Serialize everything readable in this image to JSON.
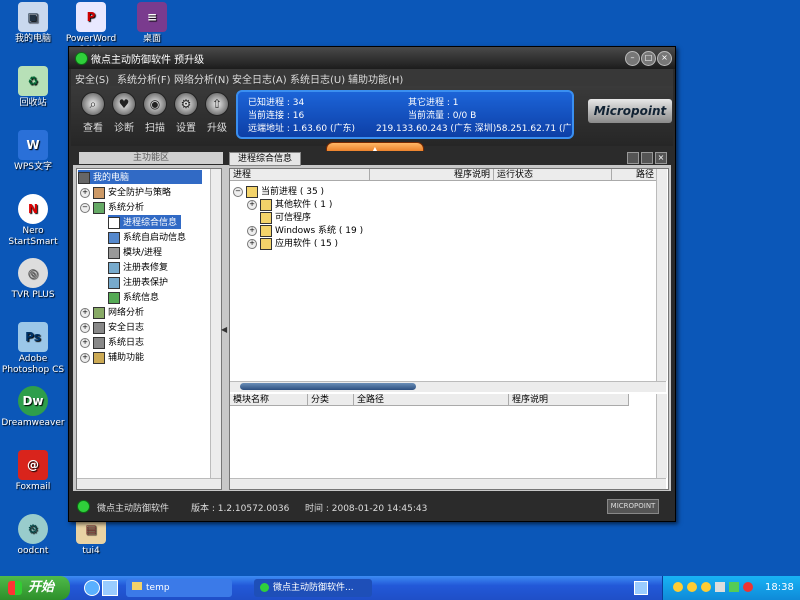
{
  "desktop": {
    "icons": [
      {
        "label": "我的电脑"
      },
      {
        "label": "PowerWord 2008"
      },
      {
        "label": "桌面"
      },
      {
        "label": "回收站"
      },
      {
        "label": "WPS文字"
      },
      {
        "label": "Nero StartSmart"
      },
      {
        "label": "TVR PLUS"
      },
      {
        "label": "Adobe Photoshop CS"
      },
      {
        "label": "Dreamweaver"
      },
      {
        "label": "Foxmail"
      },
      {
        "label": "oodcnt"
      },
      {
        "label": "tui4"
      }
    ]
  },
  "window": {
    "title": "微点主动防御软件  预升级",
    "menu": [
      "安全(S)",
      "系统分析(F)",
      "网络分析(N)",
      "安全日志(A)",
      "系统日志(U)",
      "辅助功能(H)"
    ],
    "toolbar": [
      "查看",
      "诊断",
      "扫描",
      "设置",
      "升级"
    ],
    "info": {
      "known_proc": "已知进程 : 34",
      "other_proc": "其它进程 : 1",
      "conn": "当前连接 : 16",
      "traffic": "当前流量 : 0/0 B",
      "remote_label": "远端地址 : 1.63.60 (广东)",
      "remote_2": "219.133.60.243 (广东 深圳)",
      "remote_3": "58.251.62.71 (广"
    },
    "logo": "Micropoint",
    "left_panel": {
      "title": "主功能区",
      "root": "我的电脑",
      "items": [
        {
          "label": "安全防护与策略"
        },
        {
          "label": "系统分析"
        },
        {
          "label": "进程综合信息"
        },
        {
          "label": "系统自启动信息"
        },
        {
          "label": "模块/进程"
        },
        {
          "label": "注册表修复"
        },
        {
          "label": "注册表保护"
        },
        {
          "label": "系统信息"
        },
        {
          "label": "网络分析"
        },
        {
          "label": "安全日志"
        },
        {
          "label": "系统日志"
        },
        {
          "label": "辅助功能"
        }
      ]
    },
    "right_panel": {
      "tab": "进程综合信息",
      "top_columns": [
        "进程",
        "程序说明",
        "运行状态",
        "路径"
      ],
      "tree": [
        {
          "label": "当前进程 ( 35 )"
        },
        {
          "label": "其他软件 ( 1 )"
        },
        {
          "label": "可信程序"
        },
        {
          "label": "Windows 系统 ( 19 )"
        },
        {
          "label": "应用软件 ( 15 )"
        }
      ],
      "bottom_columns": [
        "模块名称",
        "分类",
        "全路径",
        "程序说明"
      ]
    },
    "status": {
      "app": "微点主动防御软件",
      "version": "版本 : 1.2.10572.0036",
      "time": "时间 : 2008-01-20 14:45:43",
      "brand": "MICROPOINT"
    }
  },
  "taskbar": {
    "start": "开始",
    "items": [
      "temp",
      "微点主动防御软件..."
    ],
    "clock": "18:38"
  }
}
